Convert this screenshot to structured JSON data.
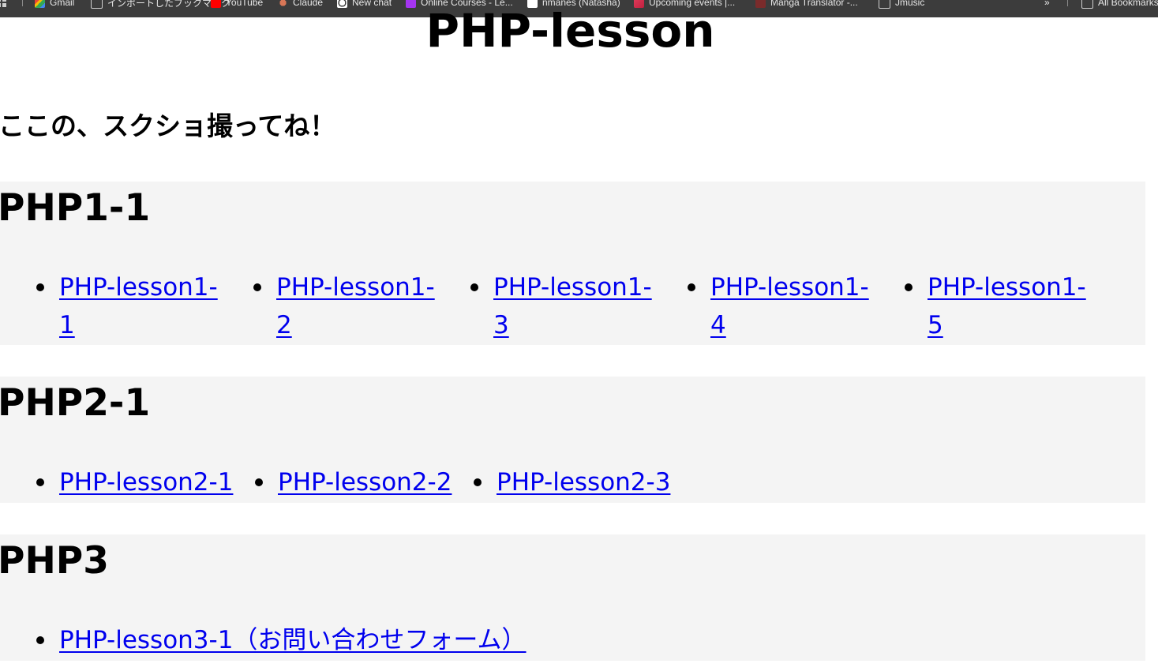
{
  "bookmarks_bar": {
    "items": [
      {
        "label": "Gmail",
        "icon": "gmail-icon"
      },
      {
        "label": "インポートしたブックマーク",
        "icon": "folder-icon"
      },
      {
        "label": "YouTube",
        "icon": "youtube-icon"
      },
      {
        "label": "Claude",
        "icon": "claude-icon"
      },
      {
        "label": "New chat",
        "icon": "chatgpt-icon"
      },
      {
        "label": "Online Courses - Le...",
        "icon": "udemy-icon"
      },
      {
        "label": "nmanes (Natasha)",
        "icon": "github-icon"
      },
      {
        "label": "Upcoming events |...",
        "icon": "events-icon"
      },
      {
        "label": "Manga Translator -...",
        "icon": "manga-icon"
      },
      {
        "label": "Jmusic",
        "icon": "folder-icon"
      }
    ],
    "overflow_label": "»",
    "all_bookmarks_label": "All Bookmarks"
  },
  "page": {
    "title": "PHP-lesson",
    "instruction": "ここの、スクショ撮ってね！"
  },
  "sections": [
    {
      "heading": "PHP1-1",
      "links": [
        {
          "line1": "PHP-lesson1-",
          "line2": "1"
        },
        {
          "line1": "PHP-lesson1-",
          "line2": "2"
        },
        {
          "line1": "PHP-lesson1-",
          "line2": "3"
        },
        {
          "line1": "PHP-lesson1-",
          "line2": "4"
        },
        {
          "line1": "PHP-lesson1-",
          "line2": "5"
        }
      ]
    },
    {
      "heading": "PHP2-1",
      "links": [
        {
          "label": "PHP-lesson2-1"
        },
        {
          "label": "PHP-lesson2-2"
        },
        {
          "label": "PHP-lesson2-3"
        }
      ]
    },
    {
      "heading": "PHP3",
      "links": [
        {
          "label": "PHP-lesson3-1（お問い合わせフォーム）"
        }
      ]
    }
  ],
  "colors": {
    "link": "#0000ee",
    "section_background": "#f4f4f4",
    "bookmarks_bar_background": "#3c3c3c"
  }
}
